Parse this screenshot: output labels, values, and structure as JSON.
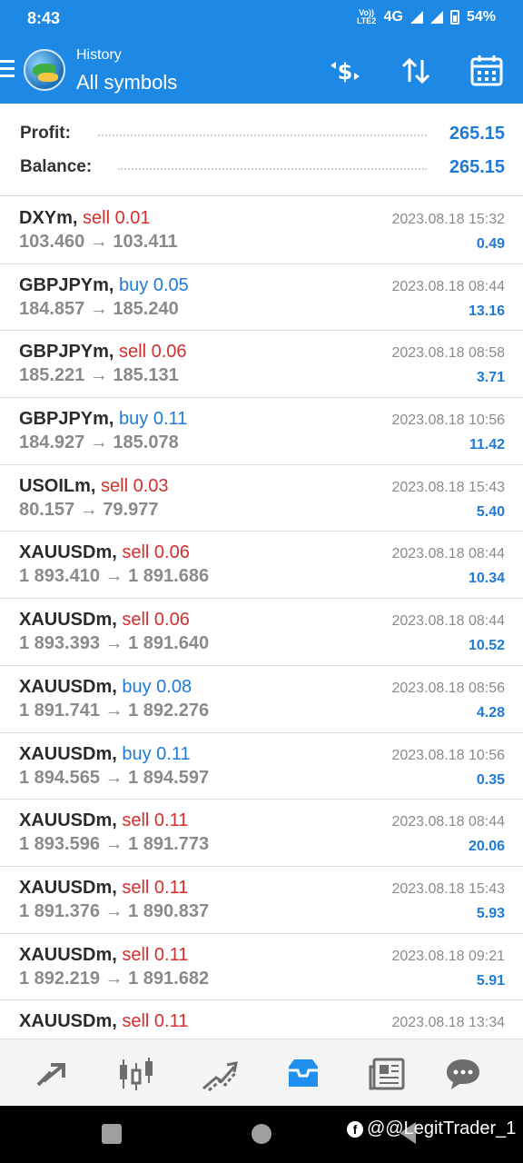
{
  "status": {
    "time": "8:43",
    "network_top": "Vo))",
    "network_bottom": "LTE2",
    "network_type": "4G",
    "battery": "54%"
  },
  "header": {
    "title": "History",
    "subtitle": "All symbols"
  },
  "summary": {
    "profit_label": "Profit:",
    "profit_value": "265.15",
    "balance_label": "Balance:",
    "balance_value": "265.15"
  },
  "trades": [
    {
      "symbol": "DXYm,",
      "side": "sell 0.01",
      "prices": "103.460 → 103.411",
      "time": "2023.08.18 15:32",
      "profit": "0.49"
    },
    {
      "symbol": "GBPJPYm,",
      "side": "buy 0.05",
      "prices": "184.857 → 185.240",
      "time": "2023.08.18 08:44",
      "profit": "13.16"
    },
    {
      "symbol": "GBPJPYm,",
      "side": "sell 0.06",
      "prices": "185.221 → 185.131",
      "time": "2023.08.18 08:58",
      "profit": "3.71"
    },
    {
      "symbol": "GBPJPYm,",
      "side": "buy 0.11",
      "prices": "184.927 → 185.078",
      "time": "2023.08.18 10:56",
      "profit": "11.42"
    },
    {
      "symbol": "USOILm,",
      "side": "sell 0.03",
      "prices": "80.157 → 79.977",
      "time": "2023.08.18 15:43",
      "profit": "5.40"
    },
    {
      "symbol": "XAUUSDm,",
      "side": "sell 0.06",
      "prices": "1 893.410 → 1 891.686",
      "time": "2023.08.18 08:44",
      "profit": "10.34"
    },
    {
      "symbol": "XAUUSDm,",
      "side": "sell 0.06",
      "prices": "1 893.393 → 1 891.640",
      "time": "2023.08.18 08:44",
      "profit": "10.52"
    },
    {
      "symbol": "XAUUSDm,",
      "side": "buy 0.08",
      "prices": "1 891.741 → 1 892.276",
      "time": "2023.08.18 08:56",
      "profit": "4.28"
    },
    {
      "symbol": "XAUUSDm,",
      "side": "buy 0.11",
      "prices": "1 894.565 → 1 894.597",
      "time": "2023.08.18 10:56",
      "profit": "0.35"
    },
    {
      "symbol": "XAUUSDm,",
      "side": "sell 0.11",
      "prices": "1 893.596 → 1 891.773",
      "time": "2023.08.18 08:44",
      "profit": "20.06"
    },
    {
      "symbol": "XAUUSDm,",
      "side": "sell 0.11",
      "prices": "1 891.376 → 1 890.837",
      "time": "2023.08.18 15:43",
      "profit": "5.93"
    },
    {
      "symbol": "XAUUSDm,",
      "side": "sell 0.11",
      "prices": "1 892.219 → 1 891.682",
      "time": "2023.08.18 09:21",
      "profit": "5.91"
    },
    {
      "symbol": "XAUUSDm,",
      "side": "sell 0.11",
      "prices": "",
      "time": "2023.08.18 13:34",
      "profit": ""
    }
  ],
  "colors": {
    "accent": "#1e88e5",
    "sell": "#d32f2f",
    "buy": "#1f7ad6",
    "profit": "#1f7ad6"
  },
  "bottom_nav": [
    {
      "icon": "quotes-icon"
    },
    {
      "icon": "chart-icon"
    },
    {
      "icon": "trade-icon"
    },
    {
      "icon": "history-icon",
      "active": true
    },
    {
      "icon": "news-icon"
    },
    {
      "icon": "messages-icon"
    }
  ],
  "watermark": "@@LegitTrader_1"
}
